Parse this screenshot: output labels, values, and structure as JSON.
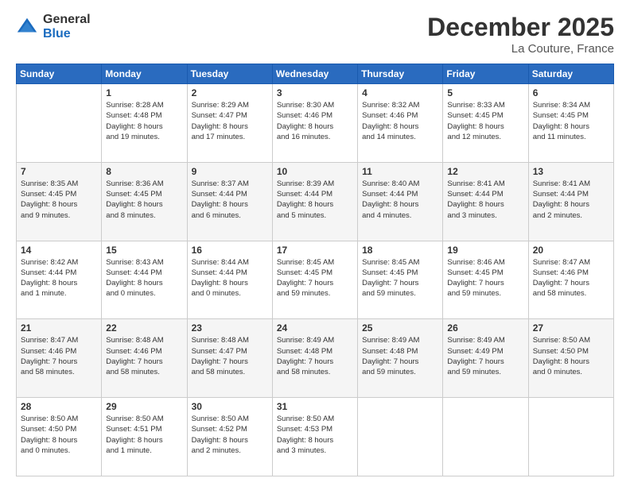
{
  "header": {
    "logo_general": "General",
    "logo_blue": "Blue",
    "title": "December 2025",
    "location": "La Couture, France"
  },
  "calendar": {
    "days_of_week": [
      "Sunday",
      "Monday",
      "Tuesday",
      "Wednesday",
      "Thursday",
      "Friday",
      "Saturday"
    ],
    "rows": [
      [
        {
          "day": "",
          "info": ""
        },
        {
          "day": "1",
          "info": "Sunrise: 8:28 AM\nSunset: 4:48 PM\nDaylight: 8 hours\nand 19 minutes."
        },
        {
          "day": "2",
          "info": "Sunrise: 8:29 AM\nSunset: 4:47 PM\nDaylight: 8 hours\nand 17 minutes."
        },
        {
          "day": "3",
          "info": "Sunrise: 8:30 AM\nSunset: 4:46 PM\nDaylight: 8 hours\nand 16 minutes."
        },
        {
          "day": "4",
          "info": "Sunrise: 8:32 AM\nSunset: 4:46 PM\nDaylight: 8 hours\nand 14 minutes."
        },
        {
          "day": "5",
          "info": "Sunrise: 8:33 AM\nSunset: 4:45 PM\nDaylight: 8 hours\nand 12 minutes."
        },
        {
          "day": "6",
          "info": "Sunrise: 8:34 AM\nSunset: 4:45 PM\nDaylight: 8 hours\nand 11 minutes."
        }
      ],
      [
        {
          "day": "7",
          "info": "Sunrise: 8:35 AM\nSunset: 4:45 PM\nDaylight: 8 hours\nand 9 minutes."
        },
        {
          "day": "8",
          "info": "Sunrise: 8:36 AM\nSunset: 4:45 PM\nDaylight: 8 hours\nand 8 minutes."
        },
        {
          "day": "9",
          "info": "Sunrise: 8:37 AM\nSunset: 4:44 PM\nDaylight: 8 hours\nand 6 minutes."
        },
        {
          "day": "10",
          "info": "Sunrise: 8:39 AM\nSunset: 4:44 PM\nDaylight: 8 hours\nand 5 minutes."
        },
        {
          "day": "11",
          "info": "Sunrise: 8:40 AM\nSunset: 4:44 PM\nDaylight: 8 hours\nand 4 minutes."
        },
        {
          "day": "12",
          "info": "Sunrise: 8:41 AM\nSunset: 4:44 PM\nDaylight: 8 hours\nand 3 minutes."
        },
        {
          "day": "13",
          "info": "Sunrise: 8:41 AM\nSunset: 4:44 PM\nDaylight: 8 hours\nand 2 minutes."
        }
      ],
      [
        {
          "day": "14",
          "info": "Sunrise: 8:42 AM\nSunset: 4:44 PM\nDaylight: 8 hours\nand 1 minute."
        },
        {
          "day": "15",
          "info": "Sunrise: 8:43 AM\nSunset: 4:44 PM\nDaylight: 8 hours\nand 0 minutes."
        },
        {
          "day": "16",
          "info": "Sunrise: 8:44 AM\nSunset: 4:44 PM\nDaylight: 8 hours\nand 0 minutes."
        },
        {
          "day": "17",
          "info": "Sunrise: 8:45 AM\nSunset: 4:45 PM\nDaylight: 7 hours\nand 59 minutes."
        },
        {
          "day": "18",
          "info": "Sunrise: 8:45 AM\nSunset: 4:45 PM\nDaylight: 7 hours\nand 59 minutes."
        },
        {
          "day": "19",
          "info": "Sunrise: 8:46 AM\nSunset: 4:45 PM\nDaylight: 7 hours\nand 59 minutes."
        },
        {
          "day": "20",
          "info": "Sunrise: 8:47 AM\nSunset: 4:46 PM\nDaylight: 7 hours\nand 58 minutes."
        }
      ],
      [
        {
          "day": "21",
          "info": "Sunrise: 8:47 AM\nSunset: 4:46 PM\nDaylight: 7 hours\nand 58 minutes."
        },
        {
          "day": "22",
          "info": "Sunrise: 8:48 AM\nSunset: 4:46 PM\nDaylight: 7 hours\nand 58 minutes."
        },
        {
          "day": "23",
          "info": "Sunrise: 8:48 AM\nSunset: 4:47 PM\nDaylight: 7 hours\nand 58 minutes."
        },
        {
          "day": "24",
          "info": "Sunrise: 8:49 AM\nSunset: 4:48 PM\nDaylight: 7 hours\nand 58 minutes."
        },
        {
          "day": "25",
          "info": "Sunrise: 8:49 AM\nSunset: 4:48 PM\nDaylight: 7 hours\nand 59 minutes."
        },
        {
          "day": "26",
          "info": "Sunrise: 8:49 AM\nSunset: 4:49 PM\nDaylight: 7 hours\nand 59 minutes."
        },
        {
          "day": "27",
          "info": "Sunrise: 8:50 AM\nSunset: 4:50 PM\nDaylight: 8 hours\nand 0 minutes."
        }
      ],
      [
        {
          "day": "28",
          "info": "Sunrise: 8:50 AM\nSunset: 4:50 PM\nDaylight: 8 hours\nand 0 minutes."
        },
        {
          "day": "29",
          "info": "Sunrise: 8:50 AM\nSunset: 4:51 PM\nDaylight: 8 hours\nand 1 minute."
        },
        {
          "day": "30",
          "info": "Sunrise: 8:50 AM\nSunset: 4:52 PM\nDaylight: 8 hours\nand 2 minutes."
        },
        {
          "day": "31",
          "info": "Sunrise: 8:50 AM\nSunset: 4:53 PM\nDaylight: 8 hours\nand 3 minutes."
        },
        {
          "day": "",
          "info": ""
        },
        {
          "day": "",
          "info": ""
        },
        {
          "day": "",
          "info": ""
        }
      ]
    ]
  }
}
